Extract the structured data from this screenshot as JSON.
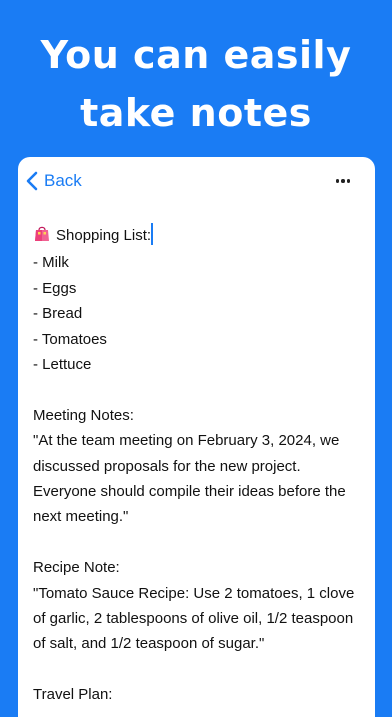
{
  "headline": {
    "line1": "You can easily",
    "line2": "take notes"
  },
  "navbar": {
    "back_label": "Back",
    "more_icon": "ellipsis-icon",
    "back_icon": "chevron-left-icon"
  },
  "note": {
    "shopping_icon": "shopping-bag-icon",
    "lines": [
      "Shopping List:",
      "- Milk",
      "- Eggs",
      "- Bread",
      "- Tomatoes",
      "- Lettuce",
      "",
      "Meeting Notes:",
      "\"At the team meeting on February 3, 2024, we",
      "discussed proposals for the new project.",
      "Everyone should compile their ideas before the",
      "next meeting.\"",
      "",
      "Recipe Note:",
      "\"Tomato Sauce Recipe: Use 2 tomatoes, 1 clove",
      "of garlic, 2 tablespoons of olive oil, 1/2 teaspoon",
      "of salt, and 1/2 teaspoon of sugar.\"",
      "",
      "Travel Plan:"
    ]
  },
  "colors": {
    "background": "#1a7cf4",
    "accent": "#1a7cf4",
    "card": "#ffffff"
  }
}
